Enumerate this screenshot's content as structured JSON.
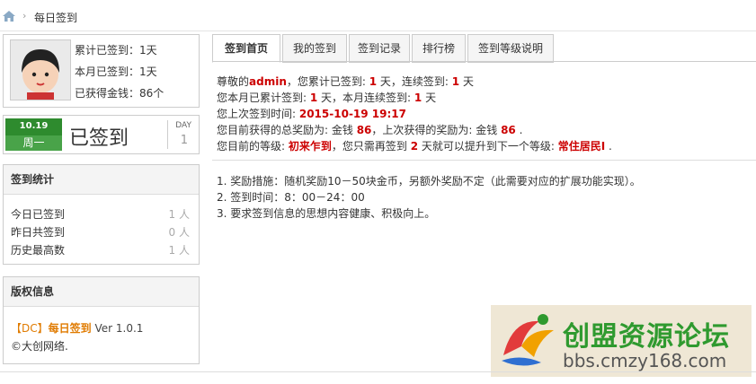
{
  "breadcrumb": {
    "separator": "›",
    "title": "每日签到"
  },
  "profile": {
    "total": "累计已签到：1天",
    "month": "本月已签到：1天",
    "gold": "已获得金钱：86个"
  },
  "sign": {
    "date": "10.19",
    "weekday": "周一",
    "status": "已签到",
    "day_label": "DAY",
    "day_value": "1"
  },
  "stats": {
    "title": "签到统计",
    "rows": [
      {
        "label": "今日已签到",
        "value": "1 人"
      },
      {
        "label": "昨日共签到",
        "value": "0 人"
      },
      {
        "label": "历史最高数",
        "value": "1 人"
      }
    ]
  },
  "copyright": {
    "title": "版权信息",
    "bracket": "【DC】",
    "name": "每日签到",
    "version": "Ver 1.0.1",
    "owner": "©大创网络."
  },
  "tabs": [
    "签到首页",
    "我的签到",
    "签到记录",
    "排行榜",
    "签到等级说明"
  ],
  "info": {
    "l1": {
      "a": "尊敬的",
      "user": "admin",
      "b": "，您累计已签到: ",
      "total": "1",
      "c": " 天，连续签到: ",
      "cont": "1",
      "d": " 天"
    },
    "l2": {
      "a": "您本月已累计签到: ",
      "m": "1",
      "b": " 天，本月连续签到: ",
      "mc": "1",
      "c": " 天"
    },
    "l3": {
      "a": "您上次签到时间: ",
      "time": "2015-10-19 19:17"
    },
    "l4": {
      "a": "您目前获得的总奖励为: 金钱 ",
      "total": "86",
      "b": "，上次获得的奖励为: 金钱 ",
      "last": "86",
      "c": " ."
    },
    "l5": {
      "a": "您目前的等级: ",
      "level": "初来乍到",
      "b": "，您只需再签到 ",
      "days": "2",
      "c": " 天就可以提升到下一个等级: ",
      "next": "常住居民I",
      "d": " ."
    }
  },
  "rules": [
    "1. 奖励措施：随机奖励10－50块金币，另额外奖励不定（此需要对应的扩展功能实现）。",
    "2. 签到时间：8：00－24：00",
    "3. 要求签到信息的思想内容健康、积极向上。"
  ],
  "watermark": {
    "title": "创盟资源论坛",
    "url": "bbs.cmzy168.com"
  },
  "colors": {
    "accent_red": "#cc0000",
    "sign_green": "#2e8b2e",
    "dc_orange": "#e07b00"
  }
}
